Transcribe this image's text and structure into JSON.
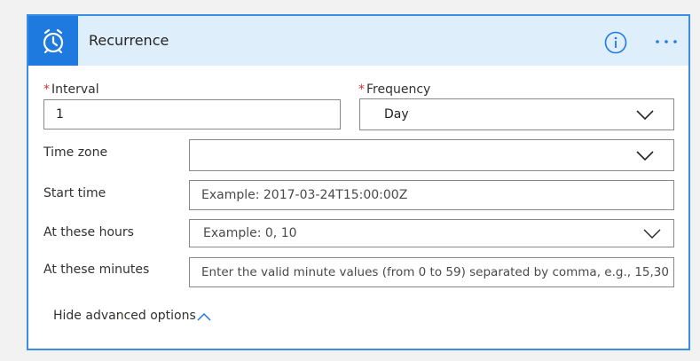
{
  "header": {
    "title": "Recurrence",
    "accent": "#1f7ae0",
    "icon": "alarm-clock-icon"
  },
  "fields": {
    "interval": {
      "label": "Interval",
      "required_mark": "*",
      "value": "1"
    },
    "frequency": {
      "label": "Frequency",
      "required_mark": "*",
      "value": "Day"
    },
    "time_zone": {
      "label": "Time zone",
      "value": ""
    },
    "start_time": {
      "label": "Start time",
      "placeholder": "Example: 2017-03-24T15:00:00Z"
    },
    "at_these_hours": {
      "label": "At these hours",
      "placeholder": "Example: 0, 10"
    },
    "at_these_minutes": {
      "label": "At these minutes",
      "placeholder": "Enter the valid minute values (from 0 to 59) separated by comma, e.g., 15,30"
    }
  },
  "advanced": {
    "label": "Hide advanced options"
  }
}
